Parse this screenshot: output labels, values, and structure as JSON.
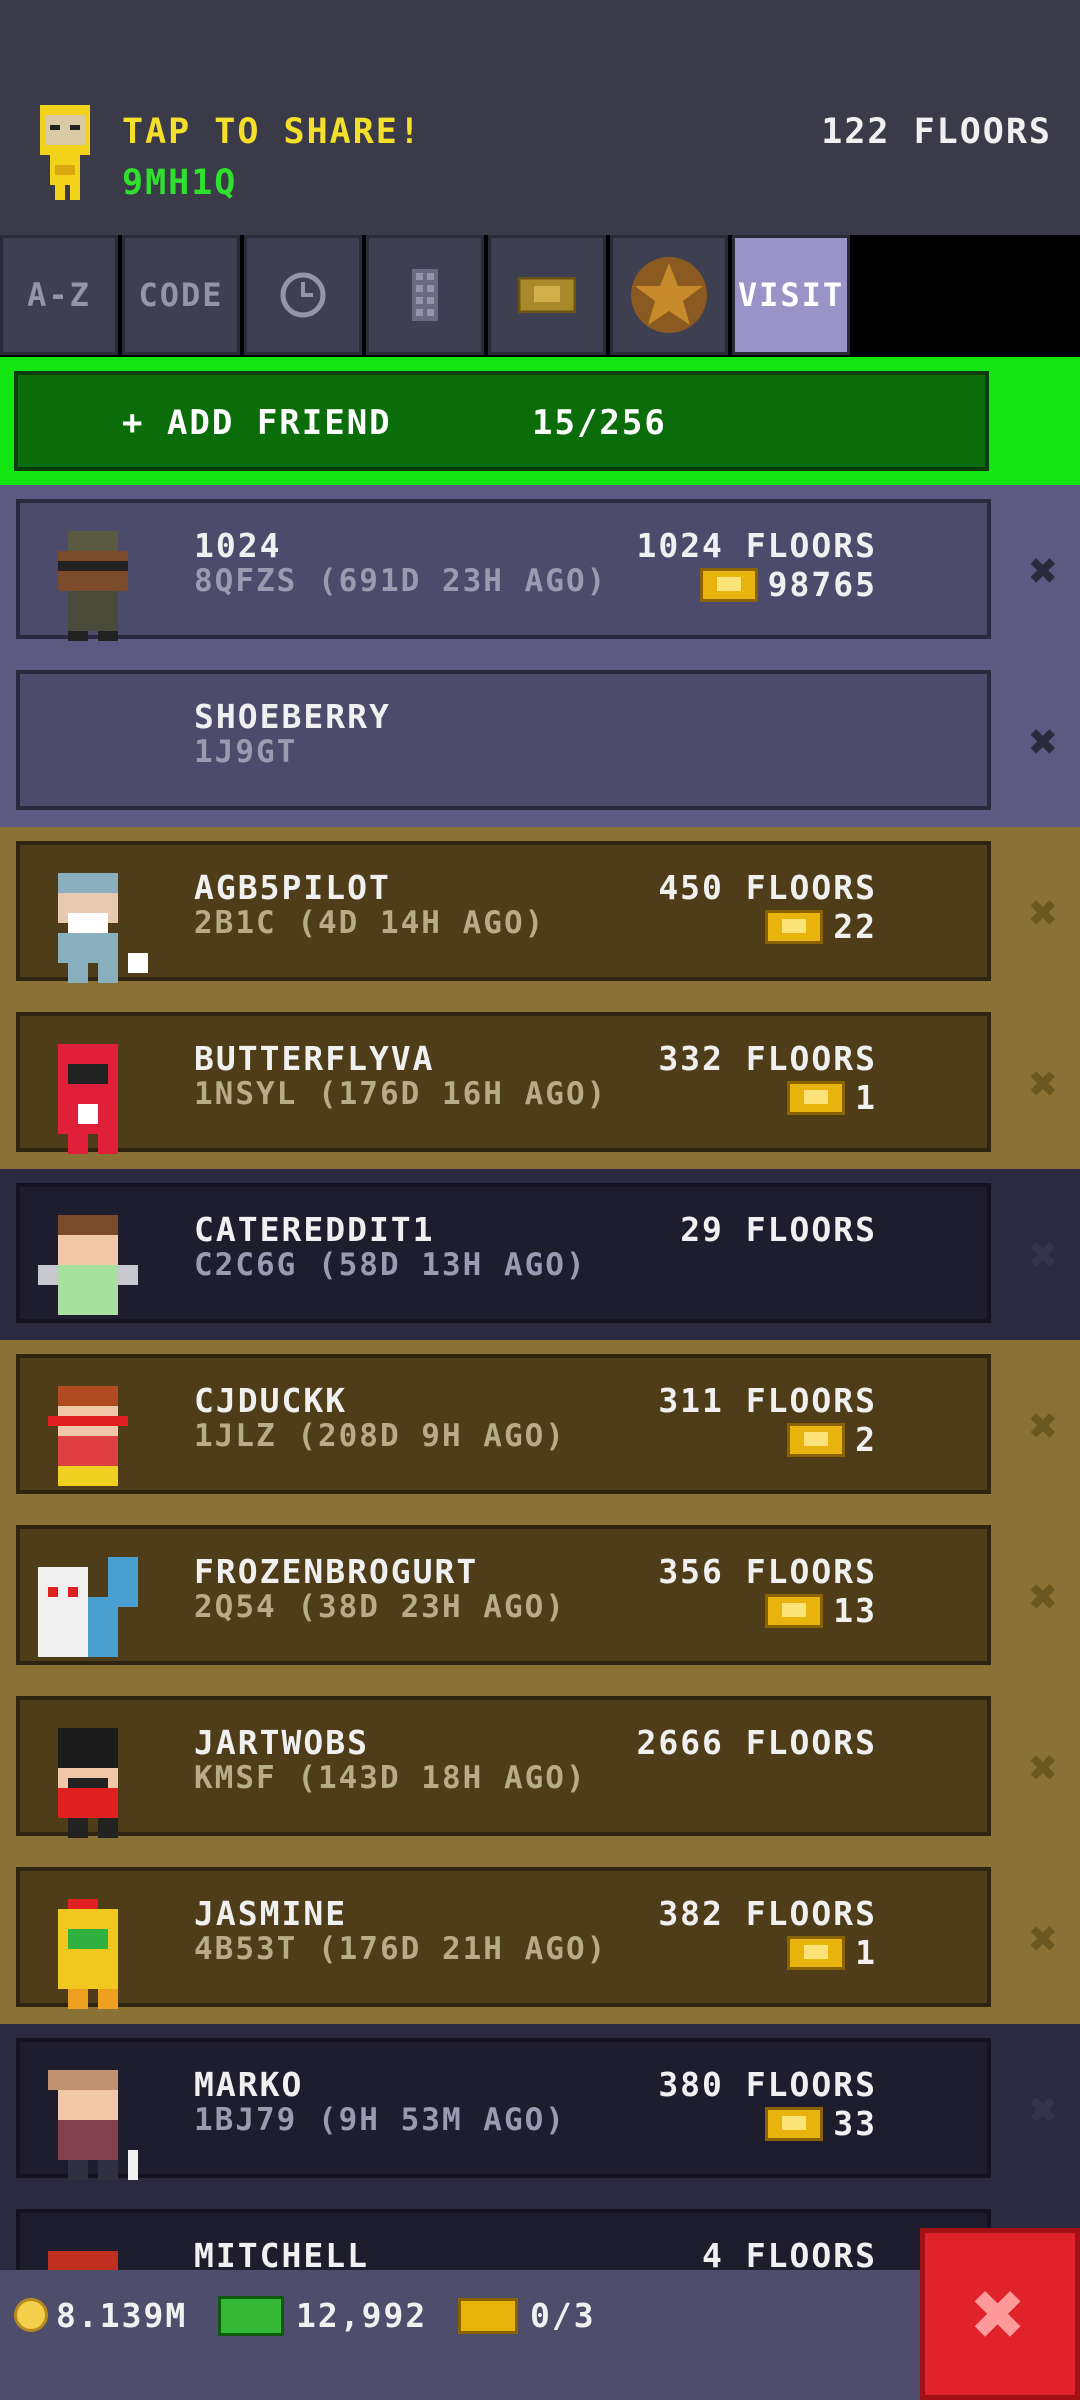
{
  "header": {
    "share_label": "TAP TO SHARE!",
    "share_code": "9MH1Q",
    "floors_total": "122 FLOORS"
  },
  "tabs": [
    {
      "label": "A-Z",
      "icon": null
    },
    {
      "label": "CODE",
      "icon": null
    },
    {
      "label": "",
      "icon": "clock-icon"
    },
    {
      "label": "",
      "icon": "building-icon"
    },
    {
      "label": "",
      "icon": "bux-icon"
    },
    {
      "label": "",
      "icon": "star-icon"
    },
    {
      "label": "VISIT",
      "icon": null,
      "active": true
    }
  ],
  "add_friend": {
    "label": "+ ADD FRIEND",
    "count": "15/256"
  },
  "friends": [
    {
      "name": "1024",
      "code": "8QFZS (691D 23H AGO)",
      "floors": "1024 FLOORS",
      "bux": "98765",
      "style": "lav"
    },
    {
      "name": "SHOEBERRY",
      "code": "1J9GT",
      "floors": "",
      "bux": "",
      "style": "lav"
    },
    {
      "name": "AGB5PILOT",
      "code": "2B1C (4D 14H AGO)",
      "floors": "450 FLOORS",
      "bux": "22",
      "style": "gold"
    },
    {
      "name": "BUTTERFLYVA",
      "code": "1NSYL (176D 16H AGO)",
      "floors": "332 FLOORS",
      "bux": "1",
      "style": "gold"
    },
    {
      "name": "CATEREDDIT1",
      "code": "C2C6G (58D 13H AGO)",
      "floors": "29 FLOORS",
      "bux": "",
      "style": "dark"
    },
    {
      "name": "CJDUCKK",
      "code": "1JLZ (208D 9H AGO)",
      "floors": "311 FLOORS",
      "bux": "2",
      "style": "gold"
    },
    {
      "name": "FROZENBROGURT",
      "code": "2Q54 (38D 23H AGO)",
      "floors": "356 FLOORS",
      "bux": "13",
      "style": "gold"
    },
    {
      "name": "JARTWOBS",
      "code": "KMSF (143D 18H AGO)",
      "floors": "2666 FLOORS",
      "bux": "",
      "style": "gold"
    },
    {
      "name": "JASMINE",
      "code": "4B53T (176D 21H AGO)",
      "floors": "382 FLOORS",
      "bux": "1",
      "style": "gold"
    },
    {
      "name": "MARKO",
      "code": "1BJ79 (9H 53M AGO)",
      "floors": "380 FLOORS",
      "bux": "33",
      "style": "dark"
    },
    {
      "name": "MITCHELL",
      "code": "",
      "floors": "4 FLOORS",
      "bux": "",
      "style": "dark"
    }
  ],
  "bottom": {
    "coins": "8.139M",
    "cash": "12,992",
    "bux": "0/3"
  },
  "colors": {
    "share_yellow": "#f4e02a",
    "code_green": "#2fe02f",
    "add_green": "#14e614",
    "close_red": "#e0232a"
  }
}
